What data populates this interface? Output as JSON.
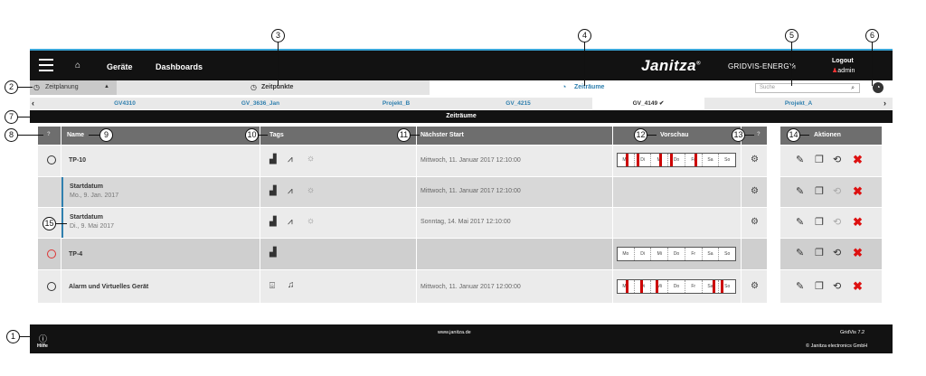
{
  "header": {
    "menu_icon": "hamburger-icon",
    "home_icon": "home-icon",
    "nav": [
      "Geräte",
      "Dashboards"
    ],
    "brand": "Janitza",
    "brand_reg": "®",
    "brand_sub": "GRIDVIS-ENERGY",
    "logout": "Logout",
    "user": "admin",
    "accent": "#3aa6d8"
  },
  "subnav": {
    "planning": "Zeitplanung",
    "points": "Zeitpunkte",
    "ranges": "Zeiträume",
    "search_placeholder": "Suche"
  },
  "projects": [
    "GV4310",
    "GV_3636_Jan",
    "Projekt_B",
    "GV_4215",
    "GV_4149",
    "Projekt_A"
  ],
  "active_project_mark": "✔",
  "title": "Zeiträume",
  "table": {
    "columns": {
      "help": "?",
      "name": "Name",
      "tags": "Tags",
      "next": "Nächster Start",
      "preview": "Vorschau",
      "preview_help": "?",
      "actions": "Aktionen"
    },
    "days": [
      "Mo",
      "Di",
      "Mi",
      "Do",
      "Fr",
      "Sa",
      "So"
    ],
    "rows": [
      {
        "name": "TP-10",
        "sub": "",
        "next": "Mittwoch, 11. Januar 2017 12:10:00",
        "clock_color": "#333333"
      },
      {
        "name": "Startdatum",
        "sub": "Mo., 9. Jan. 2017",
        "next": "Mittwoch, 11. Januar 2017 12:10:00",
        "clock_color": ""
      },
      {
        "name": "Startdatum",
        "sub": "Di., 9. Mai 2017",
        "next": "Sonntag, 14. Mai 2017 12:10:00",
        "clock_color": ""
      },
      {
        "name": "TP-4",
        "sub": "",
        "next": "",
        "clock_color": "#dd3333"
      },
      {
        "name": "Alarm und Virtuelles Gerät",
        "sub": "",
        "next": "Mittwoch, 11. Januar 2017 12:00:00",
        "clock_color": "#333333"
      }
    ]
  },
  "callouts": [
    "1",
    "2",
    "3",
    "4",
    "5",
    "6",
    "7",
    "8",
    "9",
    "10",
    "11",
    "12",
    "13",
    "14",
    "15"
  ],
  "footer": {
    "help": "Hilfe",
    "url": "www.janitza.de",
    "version": "GridVis 7.2",
    "copyright": "© Janitza electronics GmbH"
  }
}
